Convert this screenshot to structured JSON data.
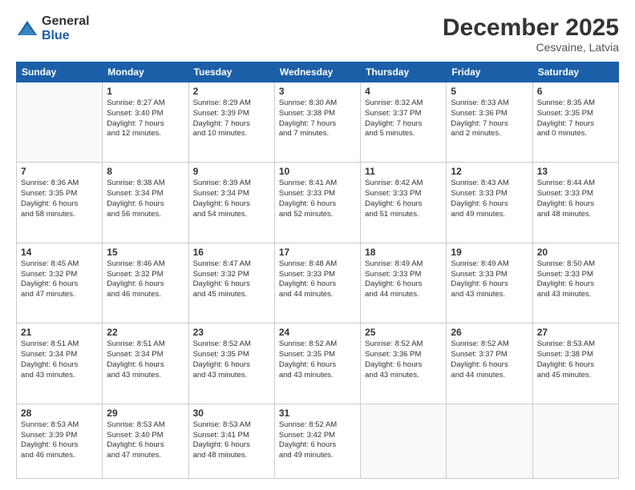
{
  "logo": {
    "general": "General",
    "blue": "Blue"
  },
  "header": {
    "month": "December 2025",
    "location": "Cesvaine, Latvia"
  },
  "weekdays": [
    "Sunday",
    "Monday",
    "Tuesday",
    "Wednesday",
    "Thursday",
    "Friday",
    "Saturday"
  ],
  "weeks": [
    [
      {
        "day": "",
        "info": ""
      },
      {
        "day": "1",
        "info": "Sunrise: 8:27 AM\nSunset: 3:40 PM\nDaylight: 7 hours\nand 12 minutes."
      },
      {
        "day": "2",
        "info": "Sunrise: 8:29 AM\nSunset: 3:39 PM\nDaylight: 7 hours\nand 10 minutes."
      },
      {
        "day": "3",
        "info": "Sunrise: 8:30 AM\nSunset: 3:38 PM\nDaylight: 7 hours\nand 7 minutes."
      },
      {
        "day": "4",
        "info": "Sunrise: 8:32 AM\nSunset: 3:37 PM\nDaylight: 7 hours\nand 5 minutes."
      },
      {
        "day": "5",
        "info": "Sunrise: 8:33 AM\nSunset: 3:36 PM\nDaylight: 7 hours\nand 2 minutes."
      },
      {
        "day": "6",
        "info": "Sunrise: 8:35 AM\nSunset: 3:35 PM\nDaylight: 7 hours\nand 0 minutes."
      }
    ],
    [
      {
        "day": "7",
        "info": "Sunrise: 8:36 AM\nSunset: 3:35 PM\nDaylight: 6 hours\nand 58 minutes."
      },
      {
        "day": "8",
        "info": "Sunrise: 8:38 AM\nSunset: 3:34 PM\nDaylight: 6 hours\nand 56 minutes."
      },
      {
        "day": "9",
        "info": "Sunrise: 8:39 AM\nSunset: 3:34 PM\nDaylight: 6 hours\nand 54 minutes."
      },
      {
        "day": "10",
        "info": "Sunrise: 8:41 AM\nSunset: 3:33 PM\nDaylight: 6 hours\nand 52 minutes."
      },
      {
        "day": "11",
        "info": "Sunrise: 8:42 AM\nSunset: 3:33 PM\nDaylight: 6 hours\nand 51 minutes."
      },
      {
        "day": "12",
        "info": "Sunrise: 8:43 AM\nSunset: 3:33 PM\nDaylight: 6 hours\nand 49 minutes."
      },
      {
        "day": "13",
        "info": "Sunrise: 8:44 AM\nSunset: 3:33 PM\nDaylight: 6 hours\nand 48 minutes."
      }
    ],
    [
      {
        "day": "14",
        "info": "Sunrise: 8:45 AM\nSunset: 3:32 PM\nDaylight: 6 hours\nand 47 minutes."
      },
      {
        "day": "15",
        "info": "Sunrise: 8:46 AM\nSunset: 3:32 PM\nDaylight: 6 hours\nand 46 minutes."
      },
      {
        "day": "16",
        "info": "Sunrise: 8:47 AM\nSunset: 3:32 PM\nDaylight: 6 hours\nand 45 minutes."
      },
      {
        "day": "17",
        "info": "Sunrise: 8:48 AM\nSunset: 3:33 PM\nDaylight: 6 hours\nand 44 minutes."
      },
      {
        "day": "18",
        "info": "Sunrise: 8:49 AM\nSunset: 3:33 PM\nDaylight: 6 hours\nand 44 minutes."
      },
      {
        "day": "19",
        "info": "Sunrise: 8:49 AM\nSunset: 3:33 PM\nDaylight: 6 hours\nand 43 minutes."
      },
      {
        "day": "20",
        "info": "Sunrise: 8:50 AM\nSunset: 3:33 PM\nDaylight: 6 hours\nand 43 minutes."
      }
    ],
    [
      {
        "day": "21",
        "info": "Sunrise: 8:51 AM\nSunset: 3:34 PM\nDaylight: 6 hours\nand 43 minutes."
      },
      {
        "day": "22",
        "info": "Sunrise: 8:51 AM\nSunset: 3:34 PM\nDaylight: 6 hours\nand 43 minutes."
      },
      {
        "day": "23",
        "info": "Sunrise: 8:52 AM\nSunset: 3:35 PM\nDaylight: 6 hours\nand 43 minutes."
      },
      {
        "day": "24",
        "info": "Sunrise: 8:52 AM\nSunset: 3:35 PM\nDaylight: 6 hours\nand 43 minutes."
      },
      {
        "day": "25",
        "info": "Sunrise: 8:52 AM\nSunset: 3:36 PM\nDaylight: 6 hours\nand 43 minutes."
      },
      {
        "day": "26",
        "info": "Sunrise: 8:52 AM\nSunset: 3:37 PM\nDaylight: 6 hours\nand 44 minutes."
      },
      {
        "day": "27",
        "info": "Sunrise: 8:53 AM\nSunset: 3:38 PM\nDaylight: 6 hours\nand 45 minutes."
      }
    ],
    [
      {
        "day": "28",
        "info": "Sunrise: 8:53 AM\nSunset: 3:39 PM\nDaylight: 6 hours\nand 46 minutes."
      },
      {
        "day": "29",
        "info": "Sunrise: 8:53 AM\nSunset: 3:40 PM\nDaylight: 6 hours\nand 47 minutes."
      },
      {
        "day": "30",
        "info": "Sunrise: 8:53 AM\nSunset: 3:41 PM\nDaylight: 6 hours\nand 48 minutes."
      },
      {
        "day": "31",
        "info": "Sunrise: 8:52 AM\nSunset: 3:42 PM\nDaylight: 6 hours\nand 49 minutes."
      },
      {
        "day": "",
        "info": ""
      },
      {
        "day": "",
        "info": ""
      },
      {
        "day": "",
        "info": ""
      }
    ]
  ]
}
